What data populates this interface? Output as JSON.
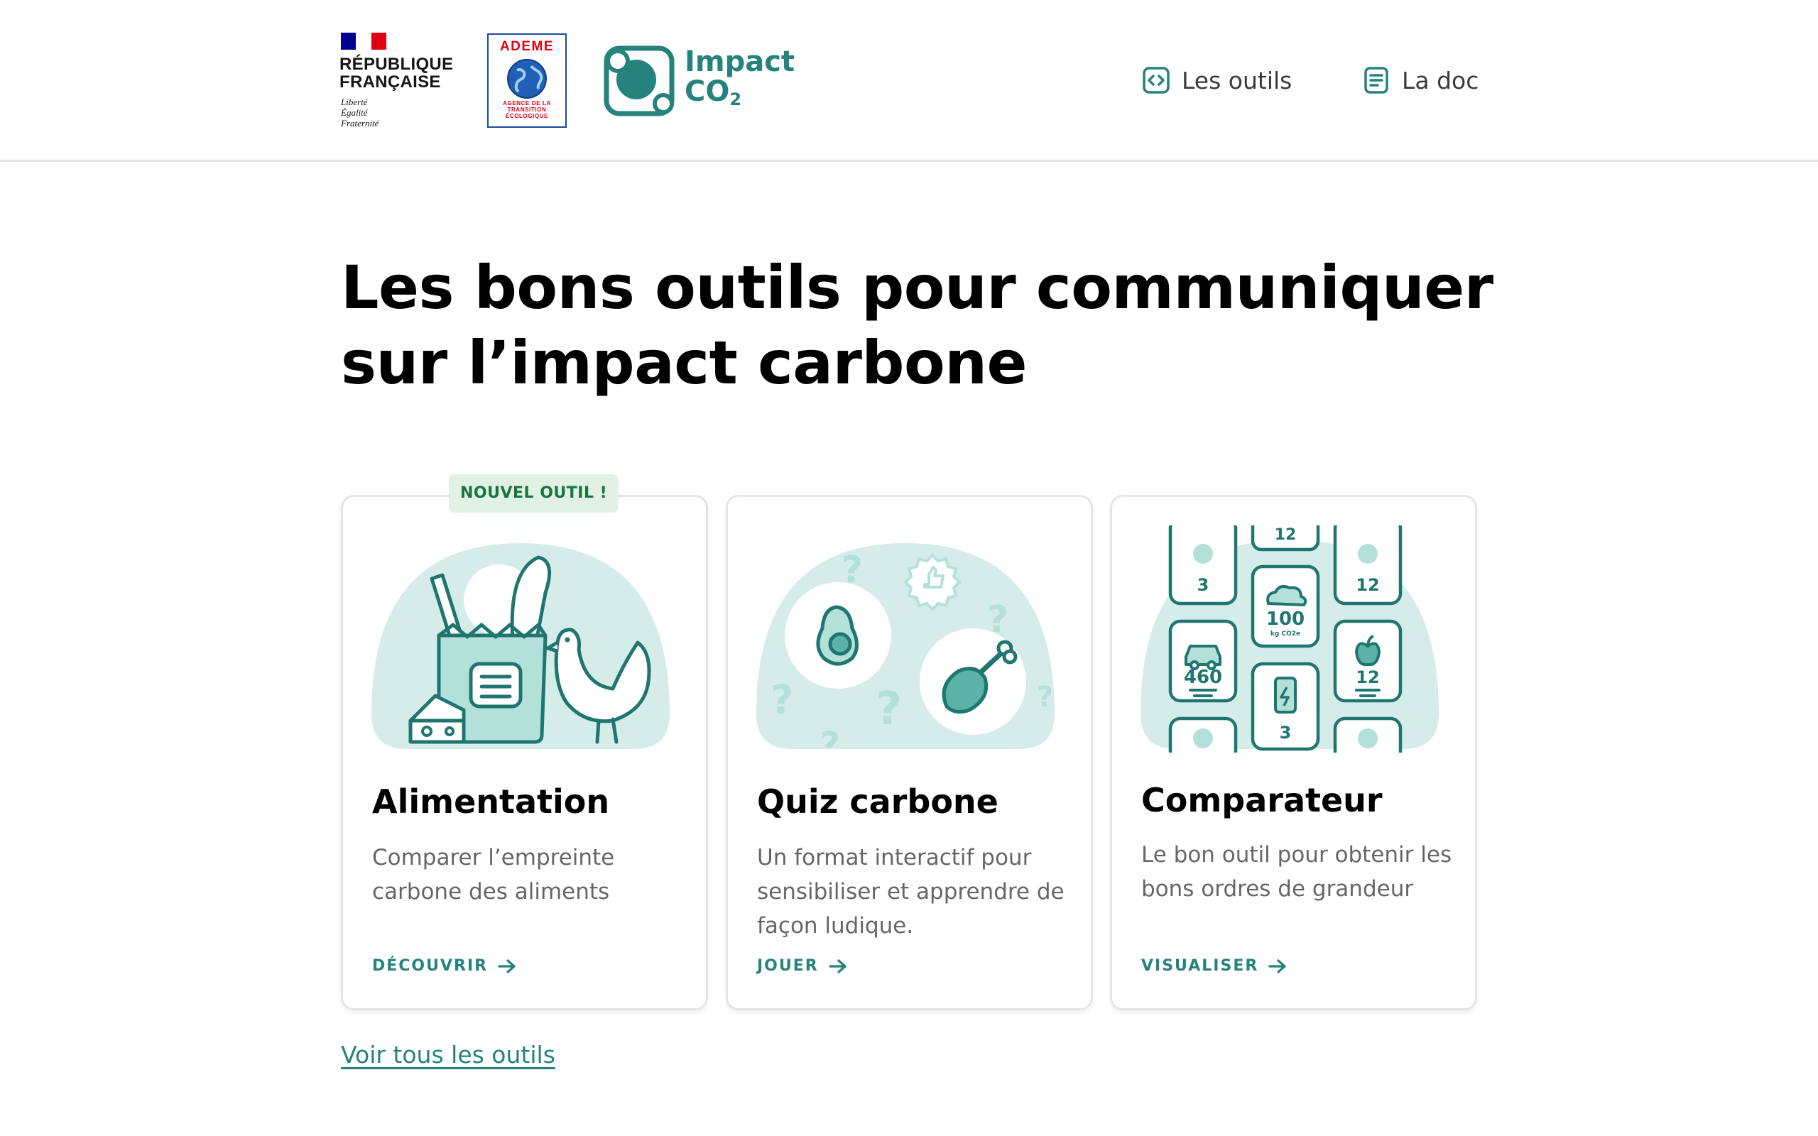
{
  "header": {
    "republique": {
      "name": "RÉPUBLIQUE\nFRANÇAISE",
      "motto": "Liberté\nÉgalité\nFraternité",
      "flag_colors": [
        "#000091",
        "#ffffff",
        "#e1000f"
      ]
    },
    "ademe": {
      "title": "ADEME",
      "subtitle": "AGENCE DE LA\nTRANSITION\nÉCOLOGIQUE"
    },
    "impact_logo": {
      "line1": "Impact",
      "line2": "CO",
      "line2_sub": "2"
    },
    "nav": [
      {
        "label": "Les outils",
        "icon": "code-brackets-icon"
      },
      {
        "label": "La doc",
        "icon": "document-icon"
      }
    ]
  },
  "main": {
    "title": "Les bons outils pour communiquer sur l’impact carbone",
    "badge": "NOUVEL OUTIL !",
    "cards": [
      {
        "title": "Alimentation",
        "description": "Comparer l’empreinte carbone des aliments",
        "link": "DÉCOUVRIR",
        "illustration": "grocery-bag-chicken-illustration"
      },
      {
        "title": "Quiz carbone",
        "description": "Un format interactif pour sensibiliser et apprendre de façon ludique.",
        "link": "JOUER",
        "illustration": "quiz-avocado-chicken-illustration"
      },
      {
        "title": "Comparateur",
        "description": "Le bon outil pour obtenir les bons ordres de grandeur",
        "link": "VISUALISER",
        "illustration": "comparator-tiles-illustration",
        "tiles": {
          "top_left": "3",
          "top_center": "12",
          "top_right": "12",
          "center": "100",
          "center_unit": "kg CO2e",
          "left": "460",
          "right": "12",
          "bottom": "3"
        }
      }
    ],
    "see_all": "Voir tous les outils"
  },
  "colors": {
    "accent": "#26827c",
    "accent_light": "#d5ece9",
    "badge_bg": "#e1f2e4",
    "badge_text": "#18753c"
  }
}
